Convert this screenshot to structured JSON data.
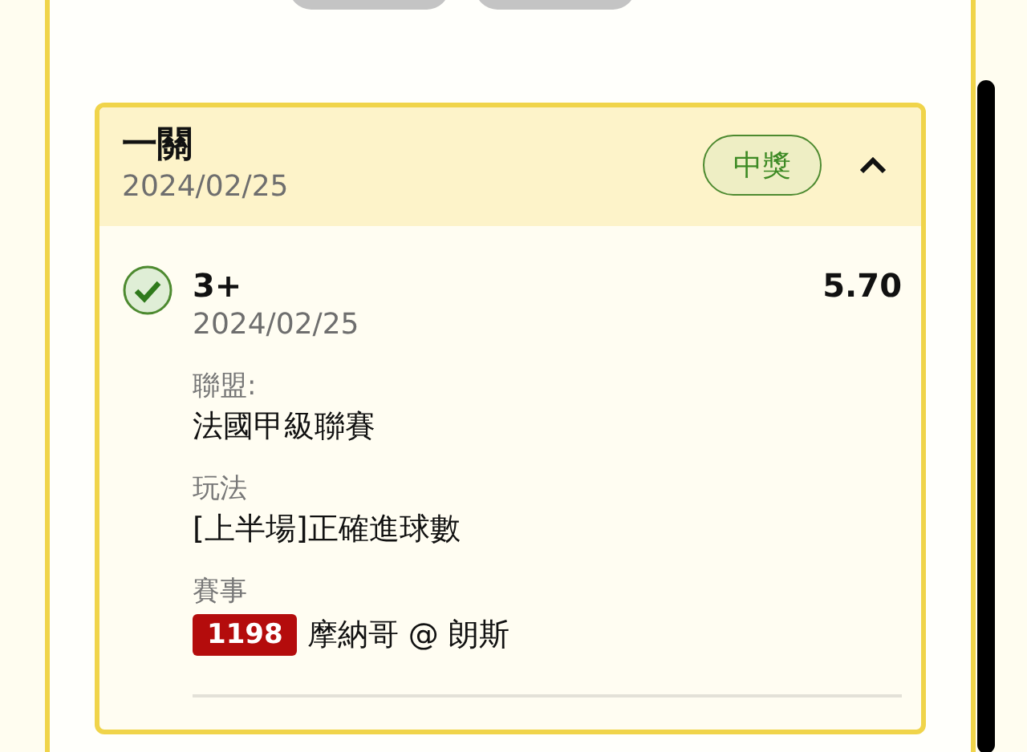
{
  "ticket": {
    "title": "一關",
    "date": "2024/02/25",
    "status_badge": "中獎",
    "expanded": true
  },
  "selection": {
    "checked": true,
    "pick": "3+",
    "date": "2024/02/25",
    "odds": "5.70",
    "fields": [
      {
        "label": "聯盟:",
        "value": "法國甲級聯賽"
      },
      {
        "label": "玩法",
        "value": "[上半場]正確進球數"
      },
      {
        "label": "賽事",
        "match_number": "1198",
        "value": "摩納哥 @ 朗斯"
      }
    ]
  }
}
